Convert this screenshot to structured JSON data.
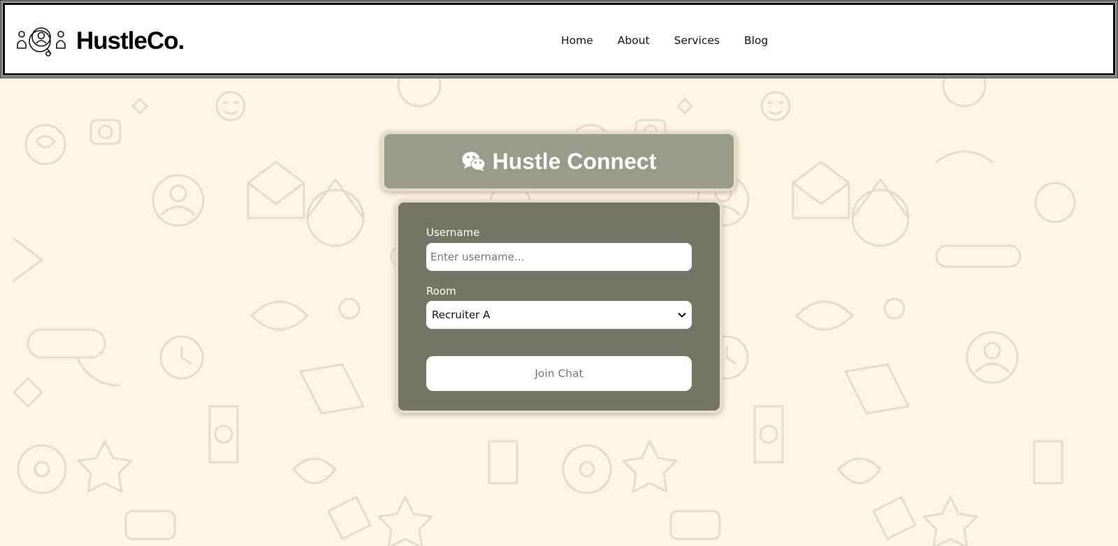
{
  "navbar": {
    "brand_name": "HustleCo.",
    "links": [
      "Home",
      "About",
      "Services",
      "Blog"
    ]
  },
  "header": {
    "title": "Hustle Connect",
    "icon": "wechat-icon"
  },
  "form": {
    "username_label": "Username",
    "username_placeholder": "Enter username...",
    "username_value": "",
    "room_label": "Room",
    "room_selected": "Recruiter A",
    "join_label": "Join Chat"
  },
  "colors": {
    "page_background": "#fdf4e4",
    "header_card": "#9a9a8a",
    "form_card": "#757566",
    "card_border": "#e8dcc8",
    "doodle_stroke": "#e6dccb"
  }
}
